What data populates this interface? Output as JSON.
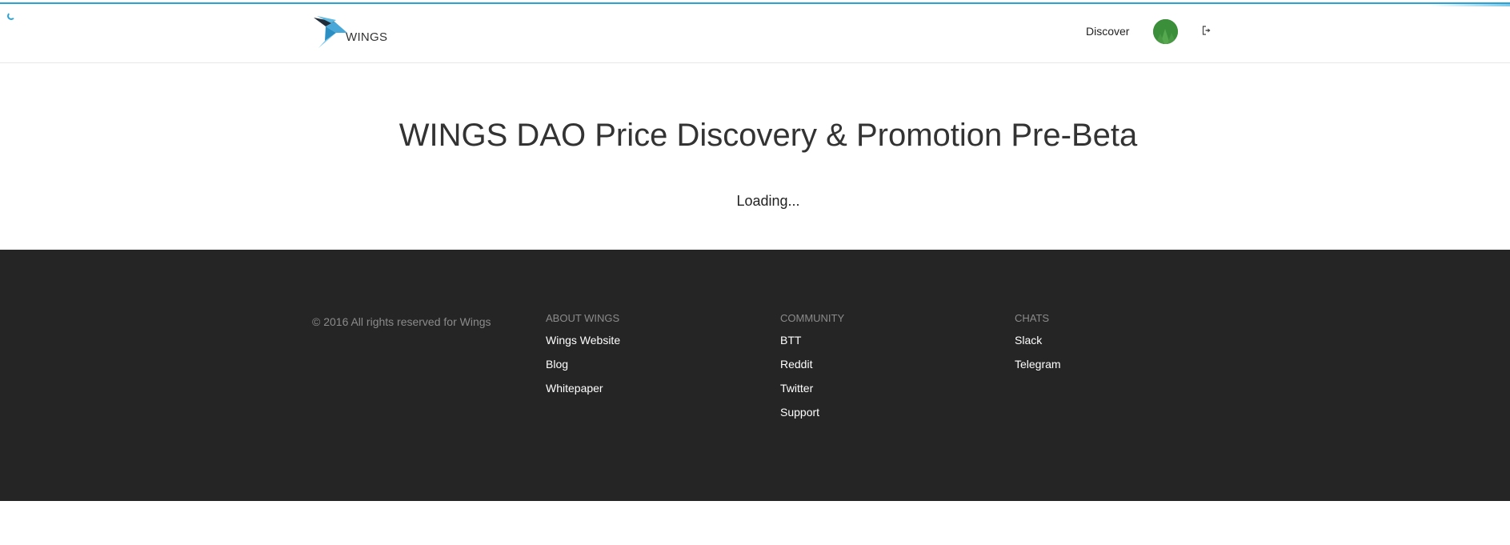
{
  "header": {
    "logo_text": "WINGS",
    "nav": {
      "discover_label": "Discover"
    },
    "colors": {
      "accent": "#29a3d6",
      "avatar": "#3c8f3a"
    }
  },
  "main": {
    "title": "WINGS DAO Price Discovery & Promotion Pre-Beta",
    "loading": "Loading..."
  },
  "footer": {
    "copyright": "© 2016 All rights reserved for Wings",
    "columns": {
      "about": {
        "title": "ABOUT WINGS",
        "links": [
          "Wings Website",
          "Blog",
          "Whitepaper"
        ]
      },
      "community": {
        "title": "COMMUNITY",
        "links": [
          "BTT",
          "Reddit",
          "Twitter",
          "Support"
        ]
      },
      "chats": {
        "title": "CHATS",
        "links": [
          "Slack",
          "Telegram"
        ]
      }
    },
    "colors": {
      "background": "#252525",
      "muted_text": "#8b8b8b",
      "link_text": "#ffffff"
    }
  },
  "icons": {
    "logo": "wings-bird-logo-icon",
    "avatar": "user-avatar-icon",
    "logout": "sign-out-icon",
    "spinner": "loading-spinner-icon"
  }
}
